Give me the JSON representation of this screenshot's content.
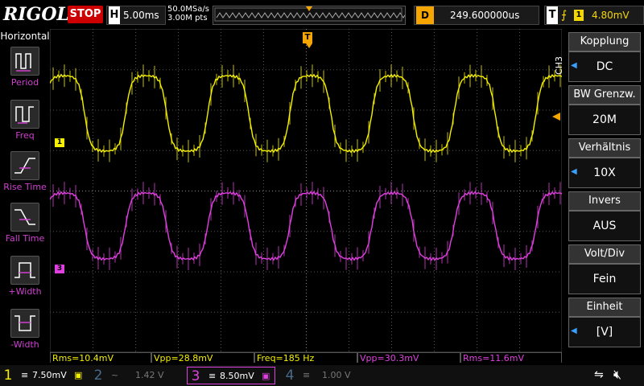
{
  "top": {
    "brand": "RIGOL",
    "run_state": "STOP",
    "h_label": "H",
    "h_value": "5.00ms",
    "sample_rate": "50.0MSa/s",
    "memory_depth": "3.00M pts",
    "d_label": "D",
    "delay": "249.600000us",
    "t_label": "T",
    "trigger_channel": "1",
    "trigger_level": "4.80mV"
  },
  "left": {
    "title": "Horizontal",
    "items": [
      {
        "label": "Period",
        "icon": "period-icon"
      },
      {
        "label": "Freq",
        "icon": "freq-icon"
      },
      {
        "label": "Rise Time",
        "icon": "rise-time-icon"
      },
      {
        "label": "Fall Time",
        "icon": "fall-time-icon"
      },
      {
        "label": "+Width",
        "icon": "pos-width-icon"
      },
      {
        "label": "-Width",
        "icon": "neg-width-icon"
      }
    ]
  },
  "right": {
    "channel_tag": "CH3",
    "items": [
      {
        "title": "Kopplung",
        "value": "DC"
      },
      {
        "title": "BW Grenzw.",
        "value": "20M"
      },
      {
        "title": "Verhältnis",
        "value": "10X"
      },
      {
        "title": "Invers",
        "value": "AUS"
      },
      {
        "title": "Volt/Div",
        "value": "Fein"
      },
      {
        "title": "Einheit",
        "value": "[V]"
      }
    ]
  },
  "markers": {
    "ch1": "1",
    "ch3": "3",
    "trigger_top": "T"
  },
  "measurements": [
    {
      "text": "Rms=10.4mV",
      "color": "#f5f000"
    },
    {
      "text": "Vpp=28.8mV",
      "color": "#f5f000"
    },
    {
      "text": "Freq=185 Hz",
      "color": "#f5f000"
    },
    {
      "text": "Vpp=30.3mV",
      "color": "#e040e0"
    },
    {
      "text": "Rms=11.6mV",
      "color": "#e040e0"
    }
  ],
  "bottom": {
    "channels": [
      {
        "num": "1",
        "coupling": "≡",
        "scale": "7.50mV",
        "color": "#f5f000",
        "active": true
      },
      {
        "num": "2",
        "coupling": "~",
        "scale": "1.42 V",
        "color": "#4a6a8a",
        "active": false
      },
      {
        "num": "3",
        "coupling": "≡",
        "scale": "8.50mV",
        "color": "#e040e0",
        "active": true
      },
      {
        "num": "4",
        "coupling": "≡",
        "scale": "1.00 V",
        "color": "#4a6a8a",
        "active": false
      }
    ]
  },
  "colors": {
    "ch1": "#f5f000",
    "ch3": "#e040e0",
    "trigger": "#f5a500",
    "accent": "#3aa0ff"
  }
}
